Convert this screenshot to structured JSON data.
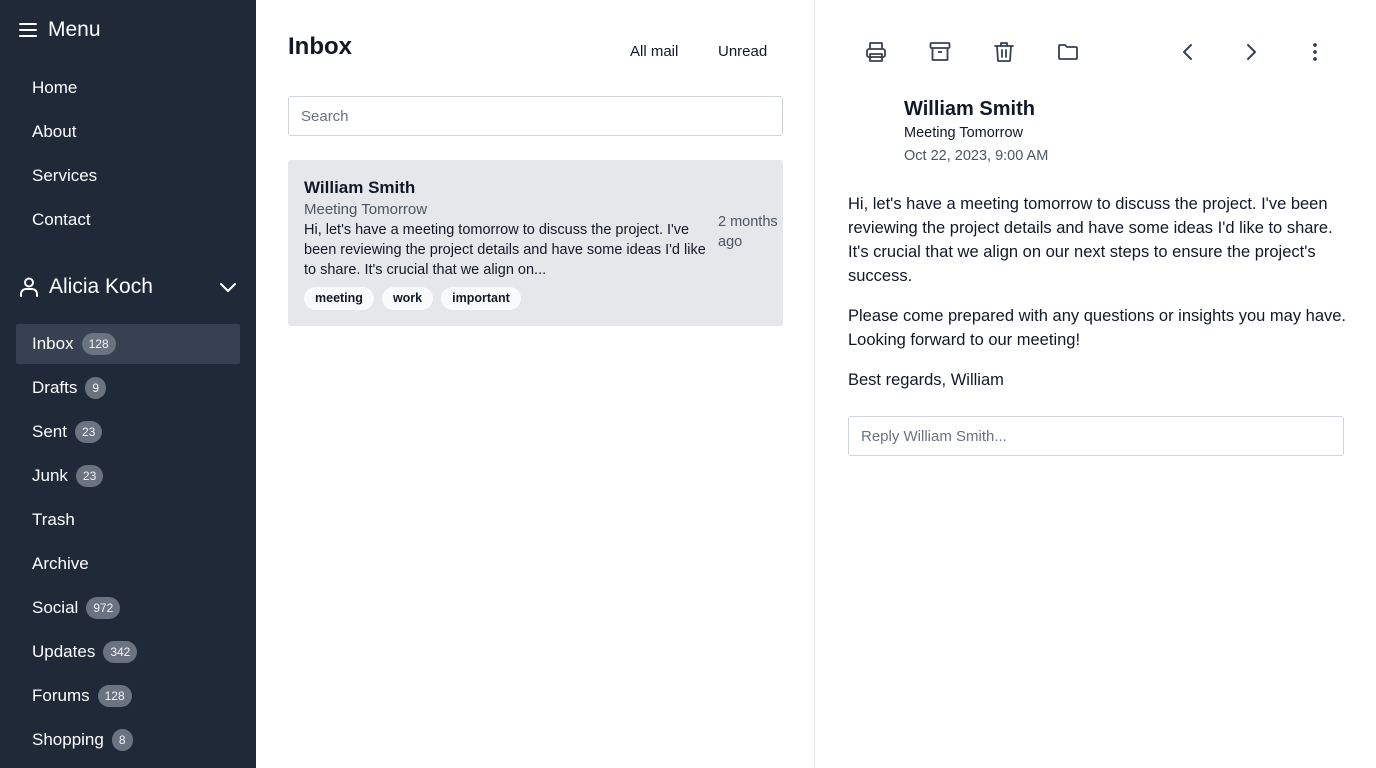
{
  "sidebar": {
    "menu_title": "Menu",
    "nav": [
      "Home",
      "About",
      "Services",
      "Contact"
    ],
    "user_name": "Alicia Koch",
    "folders": [
      {
        "label": "Inbox",
        "count": "128"
      },
      {
        "label": "Drafts",
        "count": "9"
      },
      {
        "label": "Sent",
        "count": "23"
      },
      {
        "label": "Junk",
        "count": "23"
      },
      {
        "label": "Trash",
        "count": ""
      },
      {
        "label": "Archive",
        "count": ""
      },
      {
        "label": "Social",
        "count": "972"
      },
      {
        "label": "Updates",
        "count": "342"
      },
      {
        "label": "Forums",
        "count": "128"
      },
      {
        "label": "Shopping",
        "count": "8"
      }
    ],
    "active_folder": "Inbox"
  },
  "list": {
    "title": "Inbox",
    "filters": [
      "All mail",
      "Unread"
    ],
    "search_placeholder": "Search",
    "mail": {
      "from": "William Smith",
      "subject": "Meeting Tomorrow",
      "snippet": "Hi, let's have a meeting tomorrow to discuss the project. I've been reviewing the project details and have some ideas I'd like to share. It's crucial that we align on...",
      "date": "2 months ago",
      "tags": [
        "meeting",
        "work",
        "important"
      ]
    }
  },
  "reader": {
    "toolbar_icons": [
      "printer-icon",
      "archive-icon",
      "trash-icon",
      "folder-icon",
      "chevron-left-icon",
      "chevron-right-icon",
      "more-vertical-icon"
    ],
    "from": "William Smith",
    "subject": "Meeting Tomorrow",
    "date": "Oct 22, 2023, 9:00 AM",
    "paragraphs": [
      "Hi, let's have a meeting tomorrow to discuss the project. I've been reviewing the project details and have some ideas I'd like to share. It's crucial that we align on our next steps to ensure the project's success.",
      "Please come prepared with any questions or insights you may have. Looking forward to our meeting!",
      "Best regards, William"
    ],
    "reply_placeholder": "Reply William Smith..."
  },
  "colors": {
    "sidebar_bg": "#1f2937",
    "active_folder_bg": "#374151",
    "badge_bg": "#6b7280",
    "mail_card_bg": "#e5e7eb"
  }
}
